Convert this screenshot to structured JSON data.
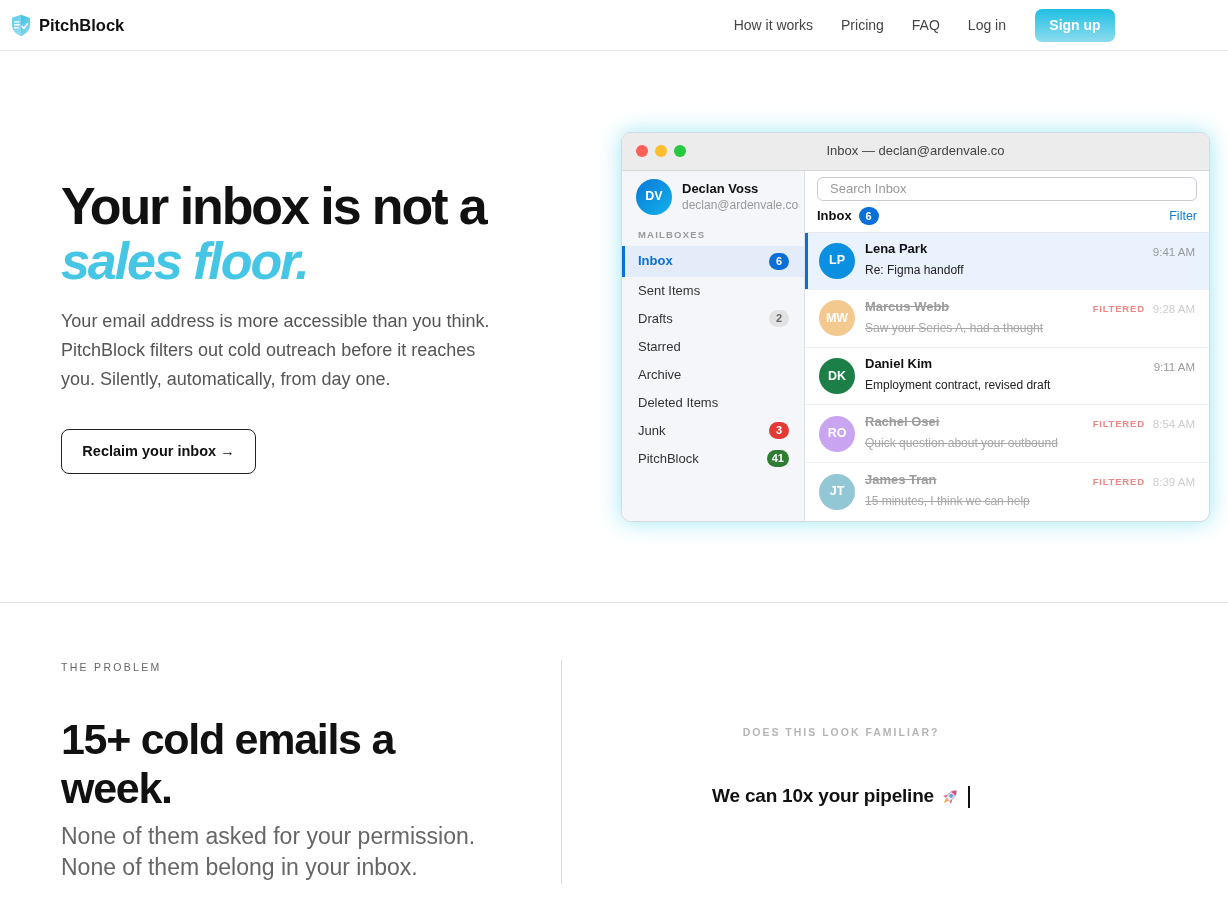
{
  "nav": {
    "brand": "PitchBlock",
    "links": [
      "How it works",
      "Pricing",
      "FAQ",
      "Log in"
    ],
    "cta": "Sign up"
  },
  "hero": {
    "title": "Your inbox is not a",
    "title_accent": "sales floor.",
    "text": "Your email address is more accessible than you think. PitchBlock filters out cold outreach before it reaches you. Silently, automatically, from day one.",
    "button": "Reclaim your inbox →"
  },
  "mail_window": {
    "title": "Inbox — declan@ardenvale.co",
    "account": {
      "initials": "DV",
      "name": "Declan Voss",
      "email": "declan@ardenvale.co"
    },
    "mailboxes_label": "MAILBOXES",
    "mailboxes": [
      {
        "label": "Inbox",
        "selected": true,
        "count": "6",
        "color": "#0a6fd6"
      },
      {
        "label": "Sent Items",
        "selected": false
      },
      {
        "label": "Drafts",
        "selected": false,
        "count": "2",
        "color": "#e2e2e2"
      },
      {
        "label": "Starred",
        "selected": false
      },
      {
        "label": "Archive",
        "selected": false
      },
      {
        "label": "Deleted Items",
        "selected": false
      },
      {
        "label": "Junk",
        "selected": false,
        "count": "3",
        "color": "#e53935"
      },
      {
        "label": "PitchBlock",
        "selected": false,
        "count": "41",
        "color": "#2e7d32"
      }
    ],
    "search": {
      "placeholder": "Search Inbox"
    },
    "list": {
      "title": "Inbox",
      "count": "6",
      "filter": "Filter"
    },
    "messages": [
      {
        "initials": "LP",
        "color": "#0b8fe0",
        "sender": "Lena Park",
        "subject": "Re: Figma handoff",
        "time": "9:41 AM",
        "selected": true,
        "filtered": false
      },
      {
        "initials": "MW",
        "color": "#f3c98f",
        "sender": "Marcus Webb",
        "subject": "Saw your Series A, had a thought",
        "time": "9:28 AM",
        "selected": false,
        "filtered": true,
        "tag": "FILTERED"
      },
      {
        "initials": "DK",
        "color": "#1b7f47",
        "sender": "Daniel Kim",
        "subject": "Employment contract, revised draft",
        "time": "9:11 AM",
        "selected": false,
        "filtered": false
      },
      {
        "initials": "RO",
        "color": "#c9a4f1",
        "sender": "Rachel Osei",
        "subject": "Quick question about your outbound",
        "time": "8:54 AM",
        "selected": false,
        "filtered": true,
        "tag": "FILTERED"
      },
      {
        "initials": "JT",
        "color": "#92c7d6",
        "sender": "James Tran",
        "subject": "15 minutes, I think we can help",
        "time": "8:39 AM",
        "selected": false,
        "filtered": true,
        "tag": "FILTERED"
      }
    ]
  },
  "problem": {
    "eyebrow": "THE PROBLEM",
    "title": "15+ cold emails a week.",
    "text": "None of them asked for your permission. None of them belong in your inbox.",
    "demo_label": "DOES THIS LOOK FAMILIAR?",
    "demo_text": "We can 10x your pipeline"
  }
}
